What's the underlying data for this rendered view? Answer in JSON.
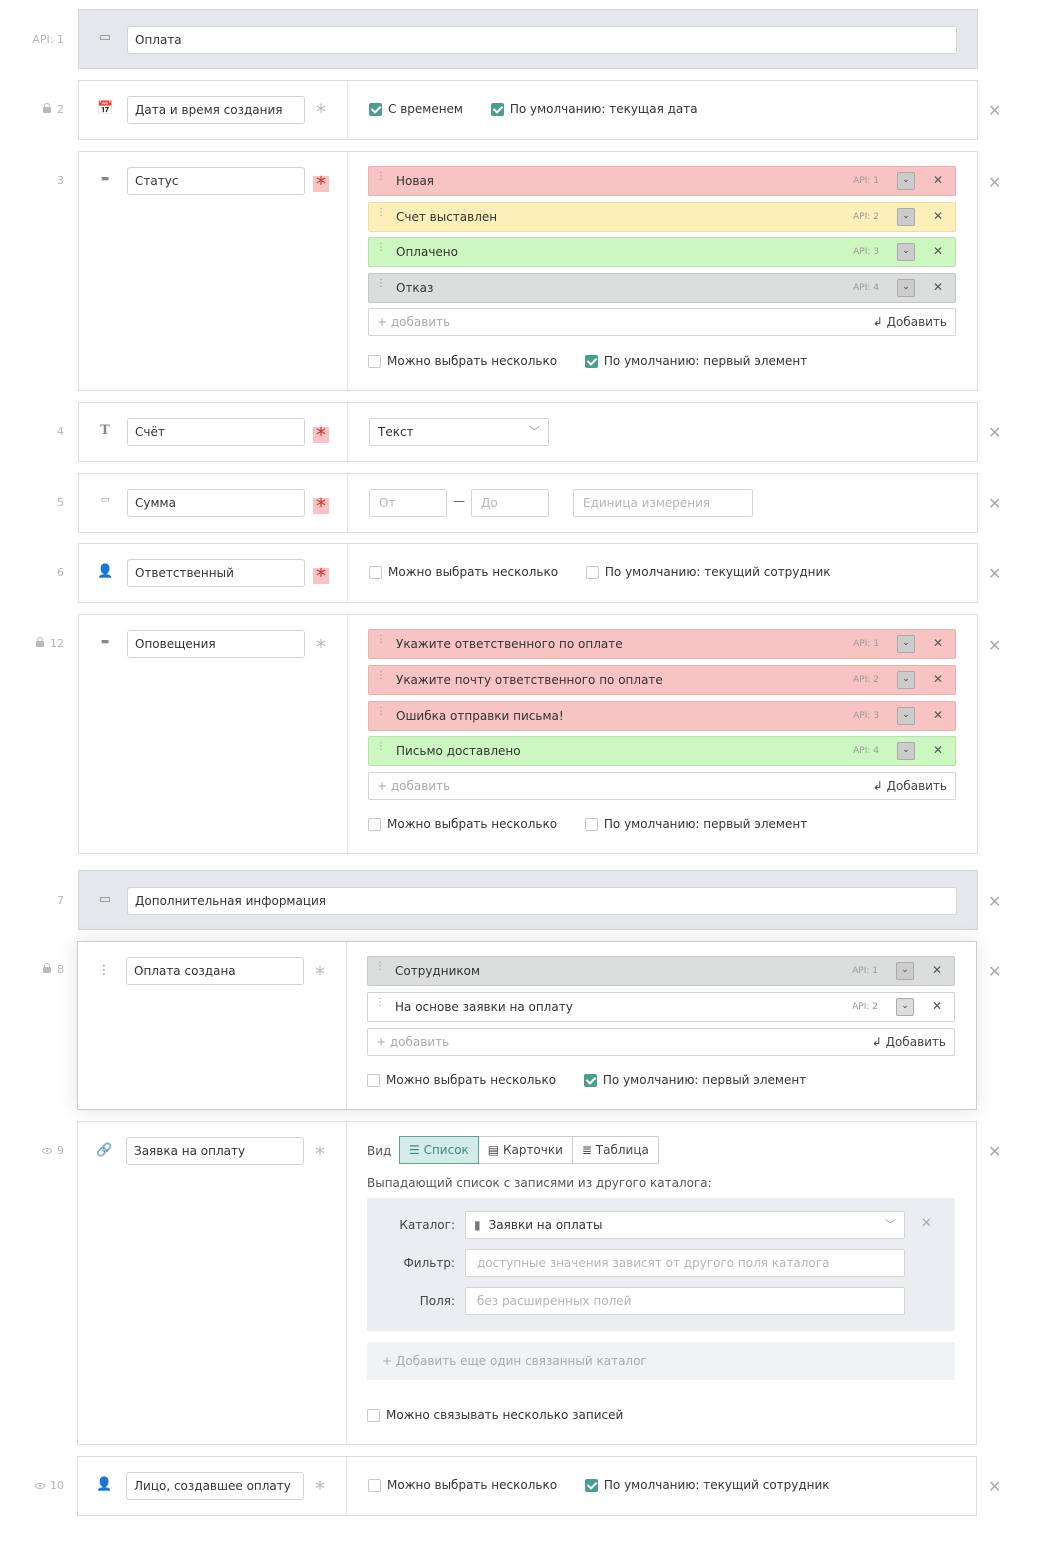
{
  "rows": {
    "r1": {
      "api": "API: 1",
      "name": "Оплата"
    },
    "r2": {
      "api": "2",
      "name": "Дата и время создания",
      "cb1": "С временем",
      "cb2": "По умолчанию: текущая дата"
    },
    "r3": {
      "api": "3",
      "name": "Статус",
      "options": [
        {
          "label": "Новая",
          "api": "API: 1"
        },
        {
          "label": "Счет выставлен",
          "api": "API: 2"
        },
        {
          "label": "Оплачено",
          "api": "API: 3"
        },
        {
          "label": "Отказ",
          "api": "API: 4"
        }
      ],
      "add_placeholder": "+ добавить",
      "add_button": "Добавить",
      "cb1": "Можно выбрать несколько",
      "cb2": "По умолчанию: первый элемент"
    },
    "r4": {
      "api": "4",
      "name": "Счёт",
      "type": "Текст"
    },
    "r5": {
      "api": "5",
      "name": "Сумма",
      "from": "От",
      "to": "До",
      "dash": "—",
      "unit": "Единица измерения"
    },
    "r6": {
      "api": "6",
      "name": "Ответственный",
      "cb1": "Можно выбрать несколько",
      "cb2": "По умолчанию: текущий сотрудник"
    },
    "r12": {
      "api": "12",
      "name": "Оповещения",
      "options": [
        {
          "label": "Укажите ответственного по оплате",
          "api": "API: 1"
        },
        {
          "label": "Укажите почту ответственного по оплате",
          "api": "API: 2"
        },
        {
          "label": "Ошибка отправки письма!",
          "api": "API: 3"
        },
        {
          "label": "Письмо доставлено",
          "api": "API: 4"
        }
      ],
      "add_placeholder": "+ добавить",
      "add_button": "Добавить",
      "cb1": "Можно выбрать несколько",
      "cb2": "По умолчанию: первый элемент"
    },
    "r7": {
      "api": "7",
      "name": "Дополнительная информация"
    },
    "r8": {
      "api": "8",
      "name": "Оплата создана",
      "options": [
        {
          "label": "Сотрудником",
          "api": "API: 1"
        },
        {
          "label": "На основе заявки на оплату",
          "api": "API: 2"
        }
      ],
      "add_placeholder": "+ добавить",
      "add_button": "Добавить",
      "cb1": "Можно выбрать несколько",
      "cb2": "По умолчанию: первый элемент"
    },
    "r9": {
      "api": "9",
      "name": "Заявка на оплату",
      "view_label": "Вид",
      "views": [
        "Список",
        "Карточки",
        "Таблица"
      ],
      "desc": "Выпадающий список с записями из другого каталога:",
      "catalog_label": "Каталог:",
      "catalog_value": "Заявки на оплаты",
      "filter_label": "Фильтр:",
      "filter_placeholder": "доступные значения зависят от другого поля каталога",
      "fields_label": "Поля:",
      "fields_placeholder": "без расширенных полей",
      "add_catalog": "+ Добавить еще один связанный каталог",
      "cb1": "Можно связывать несколько записей"
    },
    "r10": {
      "api": "10",
      "name": "Лицо, создавшее оплату",
      "cb1": "Можно выбрать несколько",
      "cb2": "По умолчанию: текущий сотрудник"
    }
  },
  "icons": {
    "close": "close-icon",
    "section": "section-icon",
    "calendar": "calendar-icon",
    "list": "list-icon",
    "text": "text-icon",
    "number": "number-icon",
    "user": "user-icon",
    "link": "link-icon",
    "drag": "drag-handle-icon"
  },
  "colors": {
    "red": "#f7c3c3",
    "yellow": "#fcefb9",
    "green": "#cdf7c0",
    "grey": "#dcdddd",
    "accent": "#4a9e8e",
    "required": "#d63031"
  }
}
